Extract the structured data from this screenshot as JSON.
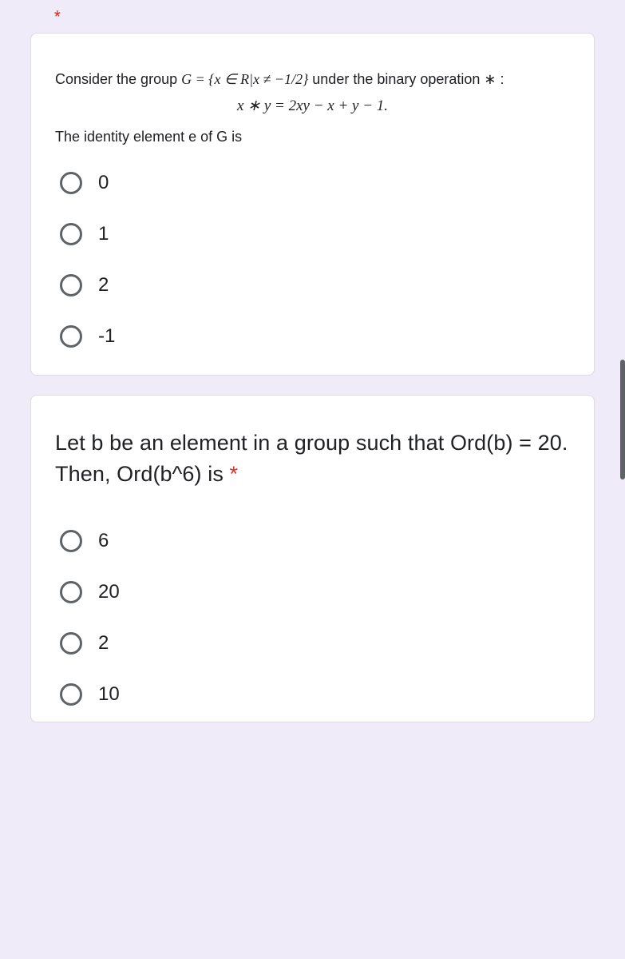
{
  "required_marker": "*",
  "question1": {
    "line1_pre": "Consider the group ",
    "line1_math": "G = {x ∈ R|x ≠ −1/2}",
    "line1_post": "  under the binary operation ∗ :",
    "line2": "x ∗ y = 2xy − x + y − 1.",
    "line3": "The identity element e of G is",
    "options": [
      "0",
      "1",
      "2",
      "-1"
    ]
  },
  "question2": {
    "text": "Let b be an element in a group such that Ord(b) = 20. Then, Ord(b^6) is ",
    "options": [
      "6",
      "20",
      "2",
      "10"
    ]
  }
}
